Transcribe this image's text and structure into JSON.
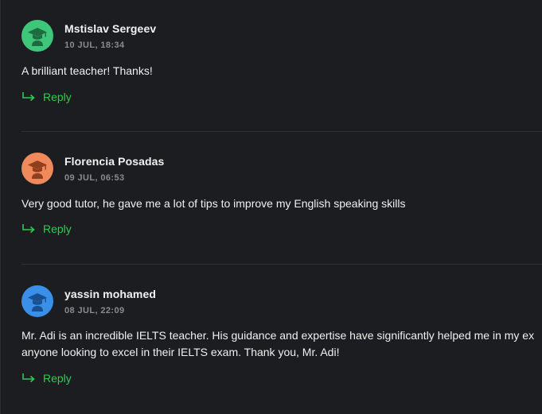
{
  "comments": [
    {
      "author": "Mstislav Sergeev",
      "date": "10 JUL, 18:34",
      "text": "A brilliant teacher! Thanks!",
      "text2": "",
      "reply_label": "Reply",
      "avatar_color": "#3ec77a",
      "avatar_icon": "graduation-cap-icon"
    },
    {
      "author": "Florencia Posadas",
      "date": "09 JUL, 06:53",
      "text": "Very good tutor, he gave me a lot of tips to improve my English speaking skills",
      "text2": "",
      "reply_label": "Reply",
      "avatar_color": "#f08a5d",
      "avatar_icon": "graduation-cap-icon"
    },
    {
      "author": "yassin mohamed",
      "date": "08 JUL, 22:09",
      "text": "Mr. Adi is an incredible IELTS teacher. His guidance and expertise have significantly helped me in my ex",
      "text2": "anyone looking to excel in their IELTS exam. Thank you, Mr. Adi!",
      "reply_label": "Reply",
      "avatar_color": "#3a8fe8",
      "avatar_icon": "graduation-cap-icon"
    }
  ],
  "colors": {
    "background": "#1c1d20",
    "reply": "#2ecc52",
    "date": "#8a8b8e"
  }
}
